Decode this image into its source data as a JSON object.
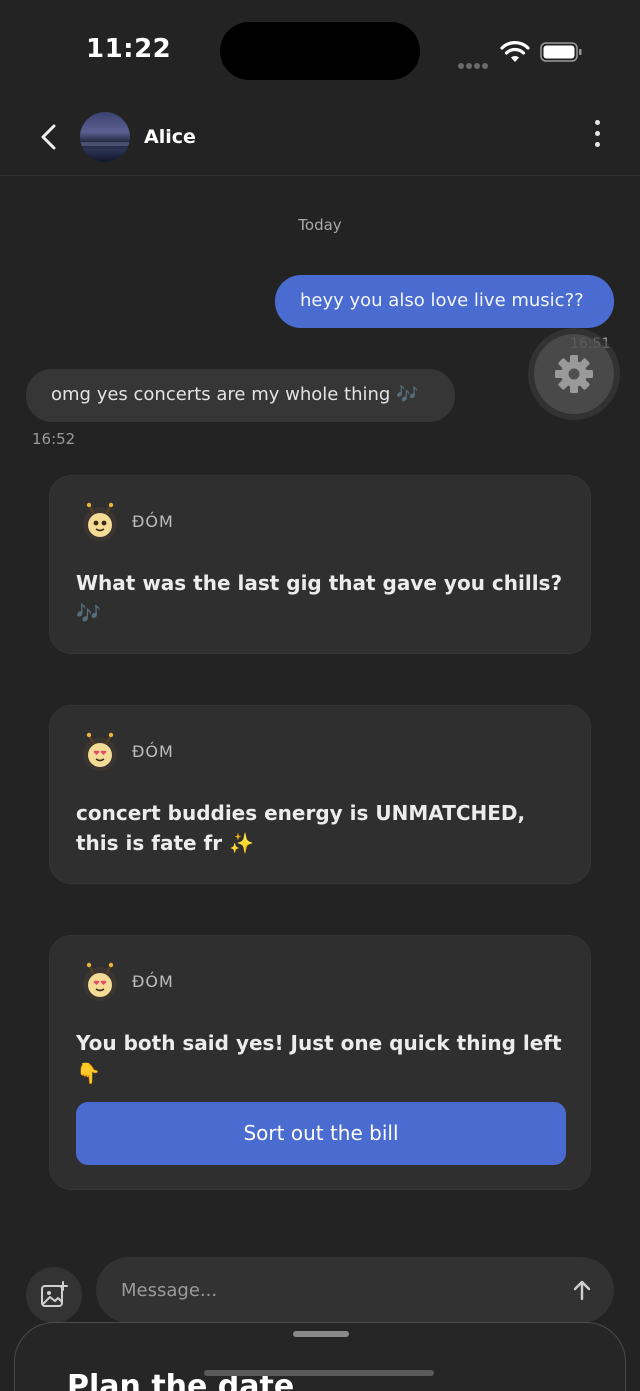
{
  "status": {
    "time": "11:22"
  },
  "header": {
    "contact_name": "Alice"
  },
  "chat": {
    "date_separator": "Today",
    "outgoing": {
      "text": "heyy you also love live music??",
      "time": "16:51"
    },
    "incoming": {
      "text": "omg yes concerts are my whole thing 🎶",
      "time": "16:52"
    }
  },
  "bot_cards": [
    {
      "name": "ĐÓM",
      "text": "What was the last gig that gave you chills? 🎶"
    },
    {
      "name": "ĐÓM",
      "text": "concert buddies energy is UNMATCHED, this is fate fr ✨"
    },
    {
      "name": "ĐÓM",
      "text": "You both said yes! Just one quick thing left 👇",
      "button": "Sort out the bill"
    }
  ],
  "composer": {
    "placeholder": "Message..."
  },
  "sheet": {
    "title": "Plan the date"
  },
  "colors": {
    "accent": "#4a6bd0",
    "background": "#232323",
    "card": "#2f2f2f"
  }
}
